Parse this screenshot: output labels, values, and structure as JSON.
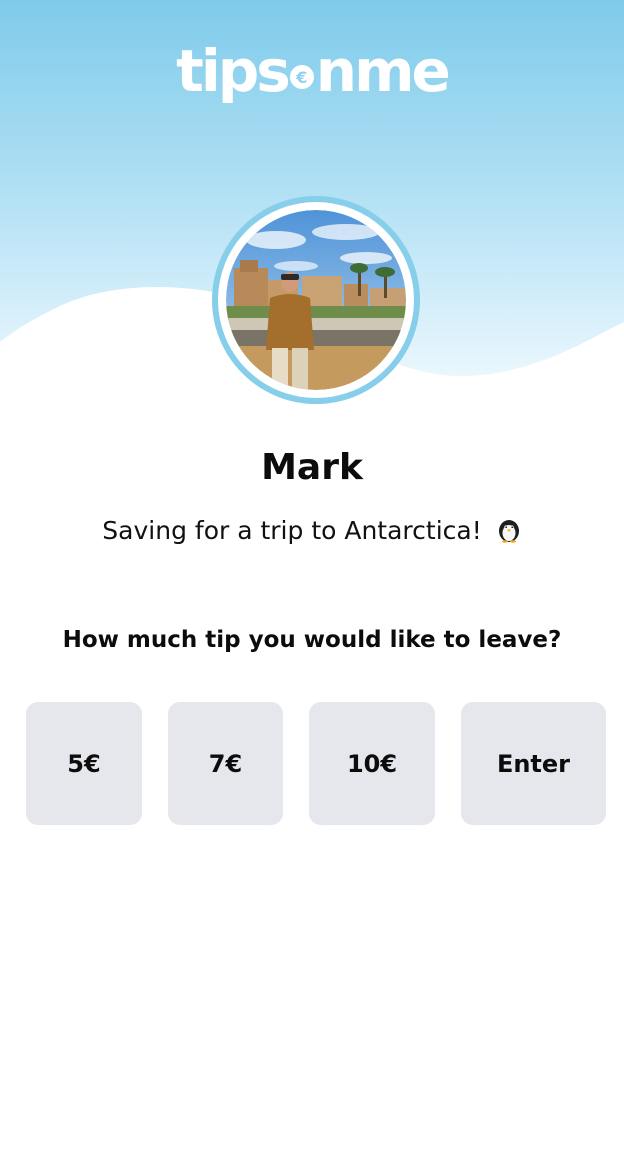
{
  "header": {
    "logo": {
      "word_left": "tips",
      "coin_symbol": "€",
      "word_right": "nme"
    },
    "colors": {
      "sky_top": "#7ecbea",
      "sky_bottom": "#e6f5fc",
      "ring": "#86ceea",
      "button_bg": "#e6e7ec"
    }
  },
  "profile": {
    "name": "Mark",
    "message": "Saving for a trip to Antarctica!",
    "message_icon": "penguin-icon",
    "avatar_icon": "profile-photo"
  },
  "tip": {
    "question": "How much tip you would like to leave?",
    "options": [
      {
        "label": "5€"
      },
      {
        "label": "7€"
      },
      {
        "label": "10€"
      },
      {
        "label": "Enter"
      }
    ]
  }
}
